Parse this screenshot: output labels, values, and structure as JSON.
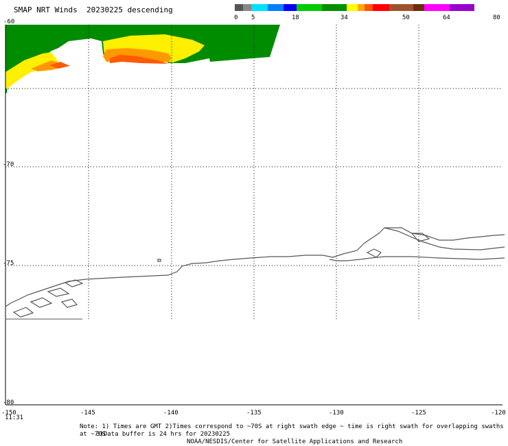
{
  "title": "SMAP NRT Winds  20230225 descending",
  "colorbar": {
    "labels": [
      "0",
      "5",
      "18",
      "34",
      "50",
      "64",
      "80"
    ],
    "segments": [
      {
        "color": "#555555"
      },
      {
        "color": "#888888"
      },
      {
        "color": "#00e0ff"
      },
      {
        "color": "#0080ff"
      },
      {
        "color": "#0000ff"
      },
      {
        "color": "#00cc00"
      },
      {
        "color": "#009000"
      },
      {
        "color": "#ffff00"
      },
      {
        "color": "#ffaa00"
      },
      {
        "color": "#ff5500"
      },
      {
        "color": "#ff0000"
      },
      {
        "color": "#a0522d"
      },
      {
        "color": "#6b2d0f"
      },
      {
        "color": "#ff00ff"
      },
      {
        "color": "#9900cc"
      }
    ]
  },
  "axes": {
    "lat_labels": [
      "-60",
      "-70",
      "-75",
      "-80"
    ],
    "lon_labels": [
      "-150",
      "-145",
      "-140",
      "-135",
      "-130",
      "-125",
      "-120"
    ],
    "corner_time": "11:31"
  },
  "notes": {
    "line1": "Note: 1) Times are GMT 2)Times correspond to ~70S at right swath edge ~ time is right swath for overlapping swaths at ~70S",
    "line2": "3)Data buffer is 24 hrs for 20230225",
    "line3": "NOAA/NESDIS/Center for Satellite Applications and Research"
  }
}
